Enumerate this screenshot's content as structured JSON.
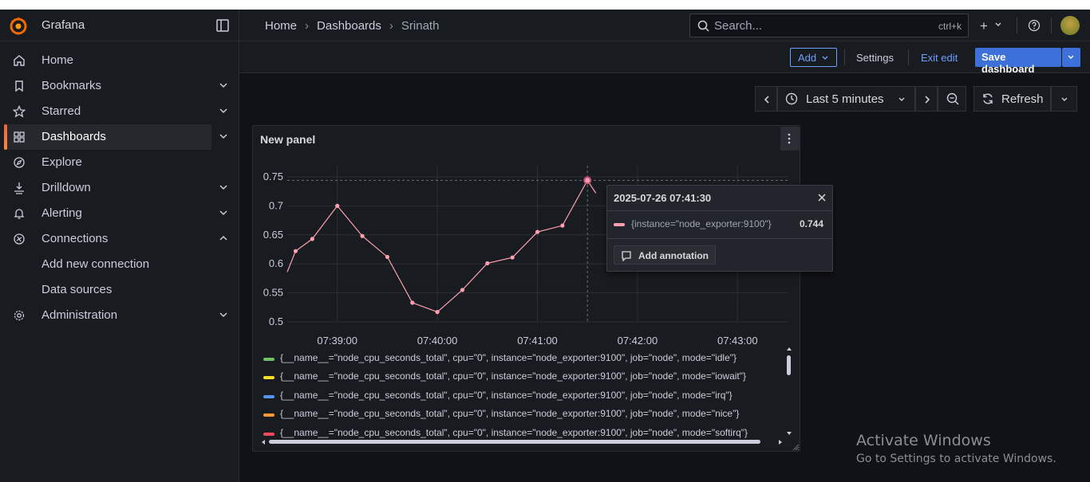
{
  "app": {
    "brand": "Grafana"
  },
  "sidebar": {
    "items": [
      {
        "label": "Home",
        "icon": "home-icon"
      },
      {
        "label": "Bookmarks",
        "icon": "bookmark-icon"
      },
      {
        "label": "Starred",
        "icon": "star-icon"
      },
      {
        "label": "Dashboards",
        "icon": "dashboards-icon",
        "active": true
      },
      {
        "label": "Explore",
        "icon": "compass-icon"
      },
      {
        "label": "Drilldown",
        "icon": "drilldown-icon"
      },
      {
        "label": "Alerting",
        "icon": "bell-icon"
      },
      {
        "label": "Connections",
        "icon": "connections-icon"
      },
      {
        "label": "Add new connection"
      },
      {
        "label": "Data sources"
      },
      {
        "label": "Administration",
        "icon": "gear-icon"
      }
    ]
  },
  "topbar": {
    "breadcrumb": [
      "Home",
      "Dashboards",
      "Srinath"
    ],
    "search_placeholder": "Search...",
    "search_shortcut": "ctrl+k",
    "plus": "+"
  },
  "toolbar": {
    "add_label": "Add",
    "settings_label": "Settings",
    "exit_label": "Exit edit",
    "save_label": "Save dashboard"
  },
  "time": {
    "range_label": "Last 5 minutes",
    "refresh_label": "Refresh"
  },
  "panel": {
    "title": "New panel",
    "legend": [
      {
        "label": "{__name__=\"node_cpu_seconds_total\", cpu=\"0\", instance=\"node_exporter:9100\", job=\"node\", mode=\"idle\"}",
        "color": "#73bf69"
      },
      {
        "label": "{__name__=\"node_cpu_seconds_total\", cpu=\"0\", instance=\"node_exporter:9100\", job=\"node\", mode=\"iowait\"}",
        "color": "#fade2a"
      },
      {
        "label": "{__name__=\"node_cpu_seconds_total\", cpu=\"0\", instance=\"node_exporter:9100\", job=\"node\", mode=\"irq\"}",
        "color": "#5794f2"
      },
      {
        "label": "{__name__=\"node_cpu_seconds_total\", cpu=\"0\", instance=\"node_exporter:9100\", job=\"node\", mode=\"nice\"}",
        "color": "#ff9830"
      },
      {
        "label": "{__name__=\"node_cpu_seconds_total\", cpu=\"0\", instance=\"node_exporter:9100\", job=\"node\", mode=\"softirq\"}",
        "color": "#f2495c"
      }
    ]
  },
  "chart_data": {
    "type": "line",
    "series": [
      {
        "name": "{instance=\"node_exporter:9100\"}",
        "color": "#ff9fb0",
        "x": [
          "07:38:30",
          "07:38:35",
          "07:38:45",
          "07:39:00",
          "07:39:15",
          "07:39:30",
          "07:39:45",
          "07:40:00",
          "07:40:15",
          "07:40:30",
          "07:40:45",
          "07:41:00",
          "07:41:15",
          "07:41:30",
          "07:41:35"
        ],
        "values": [
          0.586,
          0.622,
          0.643,
          0.7,
          0.648,
          0.612,
          0.533,
          0.517,
          0.555,
          0.601,
          0.611,
          0.655,
          0.666,
          0.744,
          0.722
        ]
      }
    ],
    "x_ticks": [
      "07:39:00",
      "07:40:00",
      "07:41:00",
      "07:42:00",
      "07:43:00"
    ],
    "y_ticks": [
      "0.75",
      "0.7",
      "0.65",
      "0.6",
      "0.55",
      "0.5"
    ],
    "ylim": [
      0.5,
      0.75
    ],
    "xlim": [
      "07:38:30",
      "07:43:30"
    ],
    "grid": true,
    "legend_placement": "bottom"
  },
  "tooltip": {
    "time": "2025-07-26 07:41:30",
    "series": "{instance=\"node_exporter:9100\"}",
    "value": "0.744",
    "annotation_label": "Add annotation"
  },
  "watermark": {
    "title": "Activate Windows",
    "subtitle": "Go to Settings to activate Windows."
  }
}
